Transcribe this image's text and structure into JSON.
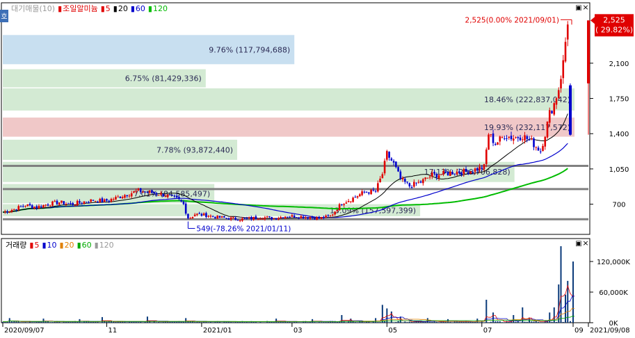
{
  "chart_data": [
    {
      "type": "candlestick",
      "legend": [
        {
          "text": "대기매물(10)",
          "color": "#9a9a9a"
        },
        {
          "text": "조일알미늄",
          "color": "#e00000"
        },
        {
          "text": "5",
          "color": "#e00000"
        },
        {
          "text": "20",
          "color": "#000000"
        },
        {
          "text": "60",
          "color": "#0000cc"
        },
        {
          "text": "120",
          "color": "#00bb00"
        }
      ],
      "y_ticks": [
        700,
        1050,
        1400,
        1750,
        2100
      ],
      "y_tick_labels": [
        "700",
        "1,050",
        "1,400",
        "1,750",
        "2,100"
      ],
      "ylim": [
        400,
        2700
      ],
      "last_price_label": "2,525",
      "last_change_label": "( 29.82%)",
      "last_price": 2525,
      "colors": {
        "up": "#e00000",
        "down": "#0000cc",
        "ma5": "#e00000",
        "ma20": "#000000",
        "ma60": "#0000cc",
        "ma120": "#00bb00"
      },
      "volume_profile": [
        {
          "label": "9.76% (117,794,688)",
          "low": 2090,
          "high": 2380,
          "width": 0.51,
          "color": "#c8dff0"
        },
        {
          "label": "6.75% (81,429,336)",
          "low": 1860,
          "high": 2040,
          "width": 0.355,
          "color": "#d3ead3"
        },
        {
          "label": "18.46% (222,837,042)",
          "low": 1630,
          "high": 1850,
          "width": 1.0,
          "color": "#d3ead3"
        },
        {
          "label": "19.93% (232,117,572)",
          "low": 1370,
          "high": 1560,
          "width": 1.0,
          "color": "#f0c8c8",
          "current": true
        },
        {
          "label": "7.78% (93,872,440)",
          "low": 1140,
          "high": 1340,
          "width": 0.41,
          "color": "#d3ead3"
        },
        {
          "label": "17.13% (206,706,828)",
          "low": 920,
          "high": 1120,
          "width": 0.895,
          "color": "#d3ead3"
        },
        {
          "label": "7.01% (84,585,497)",
          "low": 710,
          "high": 900,
          "width": 0.37,
          "color": "#d3ead3"
        },
        {
          "label": "13.09% (157,597,399)",
          "low": 580,
          "high": 700,
          "width": 0.73,
          "color": "#d3ead3"
        }
      ],
      "support_lines": [
        1080,
        850,
        550
      ],
      "annotations": [
        {
          "text": "2,525(0.00% 2021/09/01)",
          "value": 2525,
          "index": 251,
          "color": "#e00000"
        },
        {
          "text": "549(-78.26% 2021/01/11)",
          "value": 549,
          "index": 82,
          "color": "#0000cc"
        }
      ],
      "price_path": [
        [
          0,
          620
        ],
        [
          5,
          650
        ],
        [
          10,
          690
        ],
        [
          15,
          670
        ],
        [
          20,
          700
        ],
        [
          25,
          720
        ],
        [
          30,
          700
        ],
        [
          35,
          720
        ],
        [
          40,
          740
        ],
        [
          45,
          730
        ],
        [
          50,
          760
        ],
        [
          55,
          800
        ],
        [
          60,
          830
        ],
        [
          65,
          820
        ],
        [
          70,
          800
        ],
        [
          75,
          770
        ],
        [
          78,
          740
        ],
        [
          80,
          700
        ],
        [
          82,
          549
        ],
        [
          85,
          600
        ],
        [
          90,
          590
        ],
        [
          95,
          570
        ],
        [
          100,
          560
        ],
        [
          105,
          550
        ],
        [
          110,
          560
        ],
        [
          115,
          570
        ],
        [
          120,
          560
        ],
        [
          125,
          580
        ],
        [
          130,
          580
        ],
        [
          135,
          570
        ],
        [
          140,
          560
        ],
        [
          145,
          580
        ],
        [
          150,
          710
        ],
        [
          155,
          760
        ],
        [
          160,
          820
        ],
        [
          165,
          830
        ],
        [
          168,
          1000
        ],
        [
          170,
          1200
        ],
        [
          173,
          1100
        ],
        [
          176,
          950
        ],
        [
          180,
          880
        ],
        [
          185,
          920
        ],
        [
          190,
          990
        ],
        [
          195,
          1000
        ],
        [
          200,
          1020
        ],
        [
          205,
          1020
        ],
        [
          210,
          1050
        ],
        [
          213,
          1070
        ],
        [
          215,
          1400
        ],
        [
          218,
          1300
        ],
        [
          222,
          1380
        ],
        [
          226,
          1360
        ],
        [
          230,
          1380
        ],
        [
          234,
          1320
        ],
        [
          238,
          1230
        ],
        [
          240,
          1400
        ],
        [
          242,
          1600
        ],
        [
          244,
          1700
        ],
        [
          246,
          1850
        ],
        [
          248,
          2100
        ],
        [
          250,
          2525
        ]
      ],
      "last_candle": {
        "index": 252,
        "open": 1900,
        "close": 2525,
        "high": 2525,
        "low": 1390
      },
      "prev_candle": {
        "index": 251,
        "open": 1880,
        "close": 1390,
        "high": 1900,
        "low": 1380
      }
    },
    {
      "type": "bar",
      "legend": [
        {
          "text": "거래량",
          "color": "#000000"
        },
        {
          "text": "5",
          "color": "#e00000"
        },
        {
          "text": "10",
          "color": "#0000cc"
        },
        {
          "text": "20",
          "color": "#e08000"
        },
        {
          "text": "60",
          "color": "#00aa00"
        },
        {
          "text": "120",
          "color": "#999999"
        }
      ],
      "y_ticks": [
        0,
        60000,
        120000
      ],
      "y_tick_labels": [
        "0K",
        "60,000K",
        "120,000K"
      ],
      "ylim": [
        0,
        165000
      ],
      "bar_color": "#0a3a7a",
      "spikes": [
        [
          3,
          9000
        ],
        [
          18,
          8000
        ],
        [
          34,
          7000
        ],
        [
          44,
          11000
        ],
        [
          64,
          12000
        ],
        [
          81,
          9000
        ],
        [
          121,
          8000
        ],
        [
          137,
          7000
        ],
        [
          150,
          15000
        ],
        [
          154,
          8000
        ],
        [
          165,
          9000
        ],
        [
          168,
          35000
        ],
        [
          170,
          28000
        ],
        [
          172,
          22000
        ],
        [
          176,
          12000
        ],
        [
          188,
          9000
        ],
        [
          197,
          7000
        ],
        [
          210,
          8000
        ],
        [
          214,
          45000
        ],
        [
          217,
          20000
        ],
        [
          226,
          15000
        ],
        [
          230,
          30000
        ],
        [
          233,
          10000
        ],
        [
          242,
          20000
        ],
        [
          244,
          30000
        ],
        [
          246,
          75000
        ],
        [
          247,
          150000
        ],
        [
          249,
          55000
        ],
        [
          250,
          82000
        ],
        [
          252,
          120000
        ]
      ]
    }
  ],
  "x_axis": {
    "labels": [
      {
        "text": "2020/09/07",
        "index": 0
      },
      {
        "text": "11",
        "index": 46
      },
      {
        "text": "2021/01",
        "index": 88
      },
      {
        "text": "03",
        "index": 128
      },
      {
        "text": "05",
        "index": 170
      },
      {
        "text": "07",
        "index": 212
      },
      {
        "text": "09",
        "index": 252
      },
      {
        "text": "2021/09/08",
        "index": 260
      }
    ],
    "n": 254
  },
  "ui": {
    "corner_label": "호",
    "pane_buttons": [
      "▣",
      "×"
    ]
  }
}
